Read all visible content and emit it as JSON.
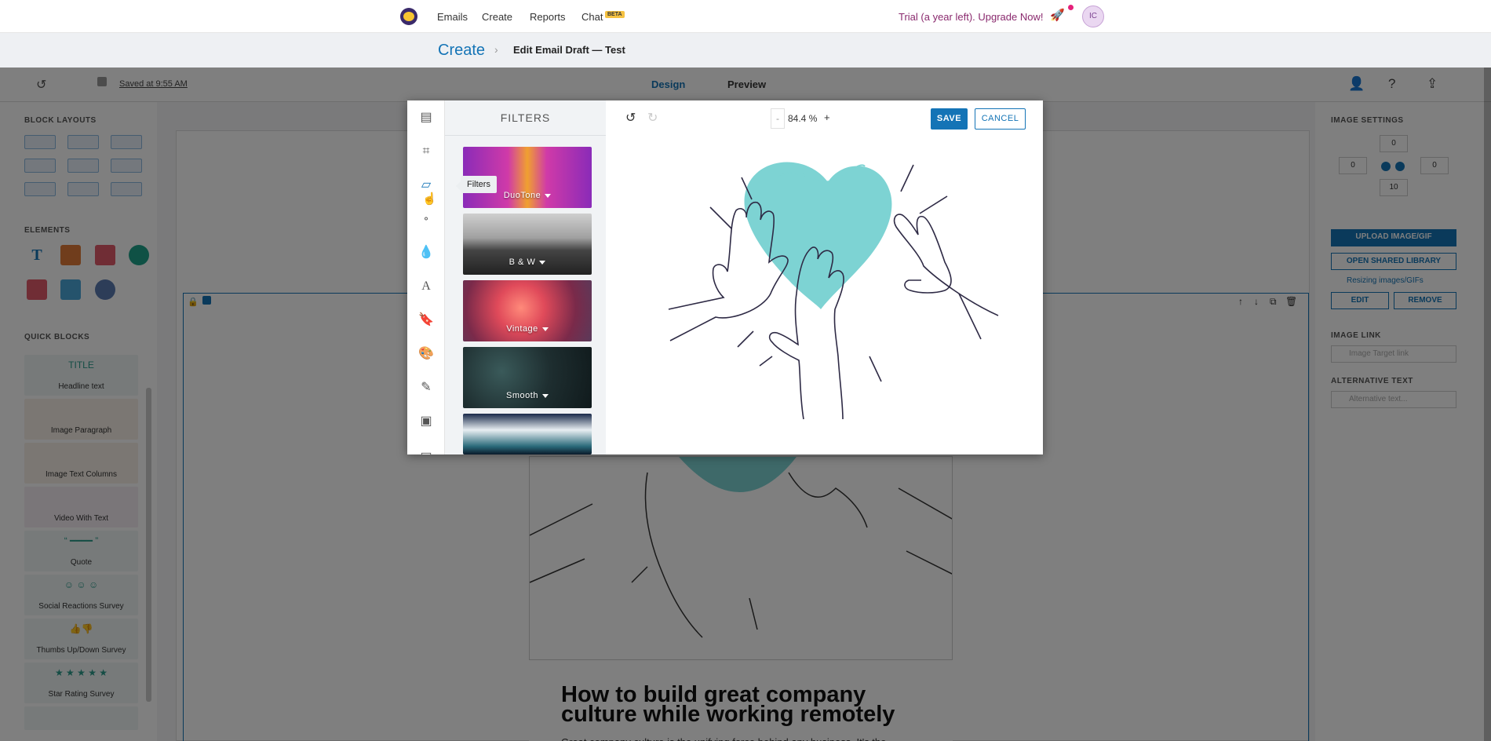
{
  "topnav": {
    "links": [
      "Emails",
      "Create",
      "Reports",
      "Chat"
    ],
    "beta_badge": "BETA",
    "trial_text": "Trial (a year left). Upgrade Now!",
    "avatar_initials": "IC"
  },
  "breadcrumb": {
    "root": "Create",
    "title": "Edit Email Draft — Test"
  },
  "toolbar": {
    "saved_text": "Saved at 9:55 AM",
    "tab_design": "Design",
    "tab_preview": "Preview"
  },
  "left_panel": {
    "block_layouts_title": "BLOCK LAYOUTS",
    "elements_title": "ELEMENTS",
    "quick_blocks_title": "QUICK BLOCKS",
    "quick_blocks": [
      {
        "label": "Headline text",
        "art": "TITLE"
      },
      {
        "label": "Image Paragraph",
        "art": ""
      },
      {
        "label": "Image Text Columns",
        "art": ""
      },
      {
        "label": "Video With Text",
        "art": ""
      },
      {
        "label": "Quote",
        "art": "“ ━━━━ ”"
      },
      {
        "label": "Social Reactions Survey",
        "art": "☺ ☺ ☺"
      },
      {
        "label": "Thumbs Up/Down Survey",
        "art": "👍👎"
      },
      {
        "label": "Star Rating Survey",
        "art": "★ ★ ★ ★ ★"
      }
    ]
  },
  "canvas": {
    "heading": "How to build great company culture while working remotely",
    "paragraph": "Great company culture is the unifying force behind any business. It's the heartbeat, the identity personality of a company."
  },
  "right_panel": {
    "title": "IMAGE SETTINGS",
    "padding_top": "0",
    "padding_left": "0",
    "padding_right": "0",
    "padding_bottom": "10",
    "upload_label": "UPLOAD IMAGE/GIF",
    "library_label": "OPEN SHARED LIBRARY",
    "resizing_label": "Resizing images/GIFs",
    "edit_label": "EDIT",
    "remove_label": "REMOVE",
    "image_link_title": "IMAGE LINK",
    "image_link_placeholder": "Image Target link",
    "alt_text_title": "ALTERNATIVE TEXT",
    "alt_text_placeholder": "Alternative text..."
  },
  "modal": {
    "filters_title": "FILTERS",
    "tooltip": "Filters",
    "filters": [
      "DuoTone",
      "B & W",
      "Vintage",
      "Smooth"
    ],
    "zoom_value": "84.4 %",
    "zoom_minus": "-",
    "zoom_plus": "+",
    "save_label": "SAVE",
    "cancel_label": "CANCEL",
    "colors": {
      "accent": "#1474b6",
      "heart": "#7dd3d3"
    }
  }
}
